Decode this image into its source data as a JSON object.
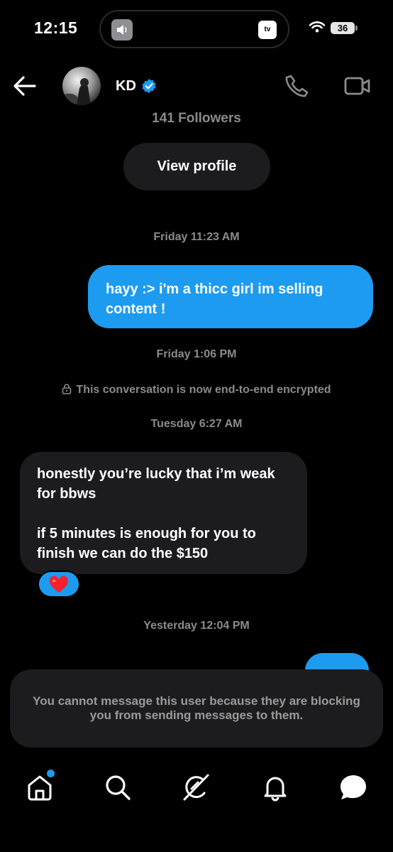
{
  "status_bar": {
    "time": "12:15",
    "island_app": "tv",
    "battery": "36"
  },
  "header": {
    "contact_name": "KD",
    "verified_icon": "verified-badge-icon",
    "followers": "141 Followers",
    "view_profile_label": "View profile"
  },
  "messages": {
    "stamp_1": "Friday 11:23 AM",
    "sent_1": "hayy :> i'm a thicc girl im selling content !",
    "stamp_2": "Friday 1:06 PM",
    "encryption_notice": "This conversation is now end-to-end encrypted",
    "stamp_3": "Tuesday 6:27 AM",
    "received_1_line_1": "honestly you’re lucky that i’m weak for bbws",
    "received_1_line_2": "if 5 minutes is enough for you to finish we can do the $150",
    "reaction": "heart",
    "stamp_4": "Yesterday 12:04 PM"
  },
  "blocked_notice": "You cannot message this user because they are blocking you from sending messages to them.",
  "nav": [
    "home-icon",
    "search-icon",
    "grok-icon",
    "notifications-icon",
    "messages-icon"
  ],
  "colors": {
    "accent": "#1d9bf0",
    "surface": "#1c1c1e",
    "muted": "#8b8b8b",
    "background": "#000000"
  }
}
